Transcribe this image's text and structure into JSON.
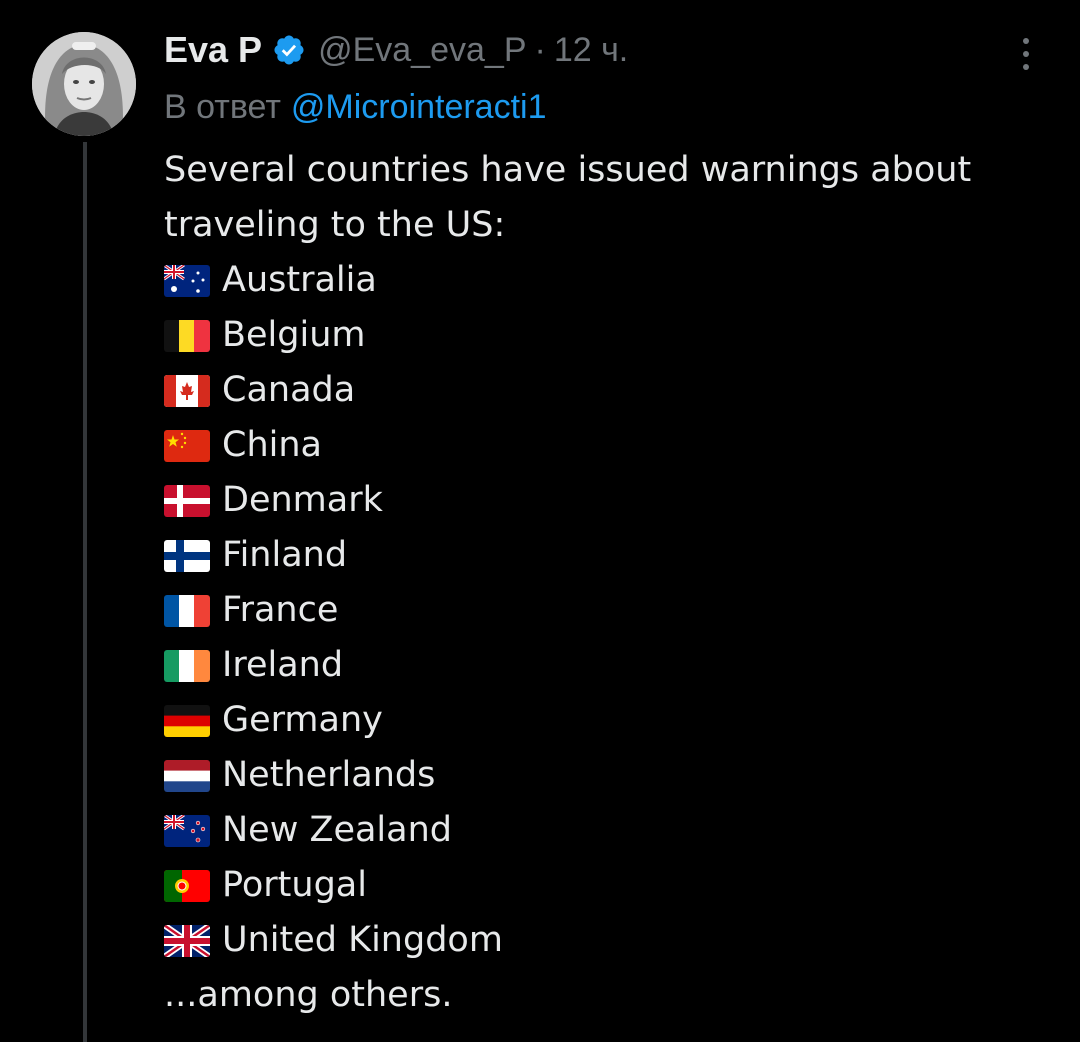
{
  "tweet": {
    "author_name": "Eva P",
    "handle": "@Eva_eva_P",
    "separator": "·",
    "time": "12 ч.",
    "reply_label": "В ответ",
    "reply_mention": "@Microinteracti1",
    "intro": "Several countries have issued warnings about traveling to the US:",
    "countries": [
      {
        "name": "Australia",
        "flag": "flag-australia-icon"
      },
      {
        "name": "Belgium",
        "flag": "flag-belgium-icon"
      },
      {
        "name": "Canada",
        "flag": "flag-canada-icon"
      },
      {
        "name": "China",
        "flag": "flag-china-icon"
      },
      {
        "name": "Denmark",
        "flag": "flag-denmark-icon"
      },
      {
        "name": "Finland",
        "flag": "flag-finland-icon"
      },
      {
        "name": "France",
        "flag": "flag-france-icon"
      },
      {
        "name": "Ireland",
        "flag": "flag-ireland-icon"
      },
      {
        "name": "Germany",
        "flag": "flag-germany-icon"
      },
      {
        "name": "Netherlands",
        "flag": "flag-netherlands-icon"
      },
      {
        "name": "New Zealand",
        "flag": "flag-new-zealand-icon"
      },
      {
        "name": "Portugal",
        "flag": "flag-portugal-icon"
      },
      {
        "name": "United Kingdom",
        "flag": "flag-united-kingdom-icon"
      }
    ],
    "outro": "...among others."
  },
  "icons": {
    "verified": "verified-badge-icon",
    "more": "more-options-icon",
    "avatar": "avatar"
  },
  "colors": {
    "background": "#000000",
    "text": "#e7e9ea",
    "secondary": "#71767b",
    "accent": "#1d9bf0",
    "thread_line": "#333639"
  }
}
